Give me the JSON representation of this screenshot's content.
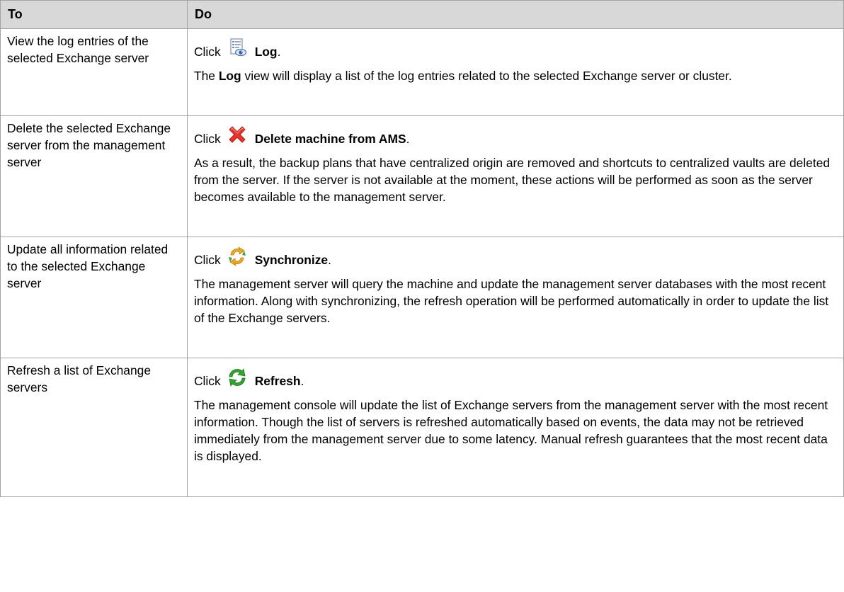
{
  "header": {
    "col_to": "To",
    "col_do": "Do"
  },
  "rows": [
    {
      "to": "View the log entries of the selected Exchange server",
      "click": "Click",
      "icon": "log-icon",
      "command": "Log",
      "period": ".",
      "desc_pre": "The ",
      "desc_bold": "Log",
      "desc_post": " view will display a list of the log entries related to the selected Exchange server or cluster."
    },
    {
      "to": "Delete the selected Exchange server from the management server",
      "click": "Click",
      "icon": "delete-icon",
      "command": "Delete machine from AMS",
      "period": ".",
      "desc": "As a result, the backup plans that have centralized origin are removed and shortcuts to centralized vaults are deleted from the server. If the server is not available at the moment, these actions will be performed as soon as the server becomes available to the management server."
    },
    {
      "to": "Update all information related to the selected Exchange server",
      "click": "Click",
      "icon": "synchronize-icon",
      "command": "Synchronize",
      "period": ".",
      "desc": "The management server will query the machine and update the management server databases with the most recent information. Along with synchronizing, the refresh operation will be performed automatically in order to update the list of the Exchange servers."
    },
    {
      "to": "Refresh a list of Exchange servers",
      "click": "Click",
      "icon": "refresh-icon",
      "command": "Refresh",
      "period": ".",
      "desc": "The management console will update the list of Exchange servers from the management server with the most recent information. Though the list of servers is refreshed automatically based on events, the data may not be retrieved immediately from the management server due to some latency. Manual refresh guarantees that the most recent data is displayed."
    }
  ],
  "colors": {
    "header_bg": "#d8d8d8",
    "border": "#a3a3a3",
    "delete_red": "#e8332a",
    "refresh_green": "#2fa52f",
    "sync_orange": "#f0a81c"
  }
}
